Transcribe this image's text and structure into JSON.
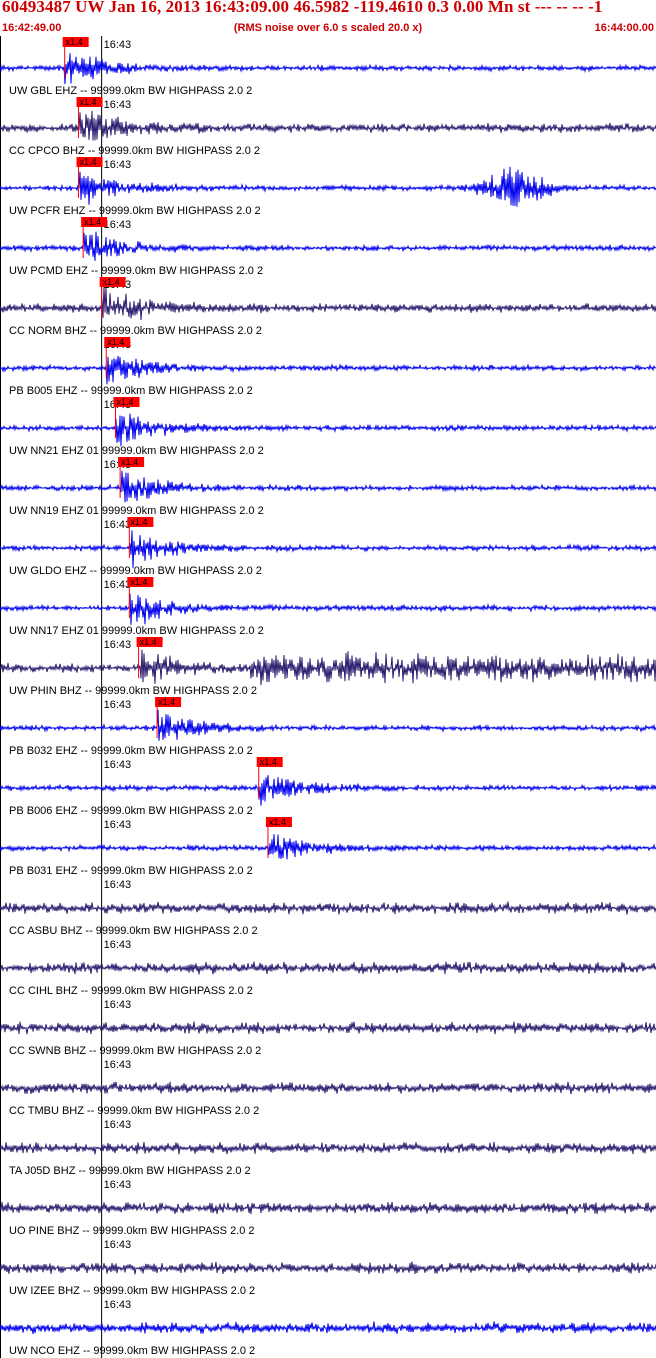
{
  "header": {
    "title": "60493487 UW Jan 16, 2013 16:43:09.00   46.5982 -119.4610  0.3 0.00 Mn st --- -- --  -1",
    "start_time": "16:42:49.00",
    "noise_note": "(RMS noise over 6.0 s scaled 20.0 x)",
    "end_time": "16:44:00.00"
  },
  "colors": {
    "title": "#cc0000",
    "trace_blue": "#0000ee",
    "trace_dark": "#2a1a6e",
    "pick_box": "#ff0000",
    "tick_line": "#000000"
  },
  "chart_data": {
    "type": "line",
    "time_axis": {
      "start": "16:42:49.00",
      "end": "16:44:00.00",
      "minute_label": "16:43",
      "minute_tick": "16:43:00"
    },
    "pick_label": "x1.4",
    "traces": [
      {
        "label": "UW GBL EHZ -- 99999.0km BW  HIGHPASS  2.0  2",
        "color": "blue",
        "pick_time": "16:42:56.0"
      },
      {
        "label": "CC CPCO BHZ -- 99999.0km BW  HIGHPASS  2.0  2",
        "color": "dark",
        "pick_time": "16:42:57.5"
      },
      {
        "label": "UW PCFR EHZ -- 99999.0km BW  HIGHPASS  2.0  2",
        "color": "blue",
        "pick_time": "16:42:57.5"
      },
      {
        "label": "UW PCMD EHZ -- 99999.0km BW  HIGHPASS  2.0  2",
        "color": "blue",
        "pick_time": "16:42:58.0"
      },
      {
        "label": "CC NORM BHZ -- 99999.0km BW  HIGHPASS  2.0  2",
        "color": "dark",
        "pick_time": "16:43:00.0"
      },
      {
        "label": "PB B005 EHZ -- 99999.0km BW  HIGHPASS  2.0  2",
        "color": "blue",
        "pick_time": "16:43:00.5"
      },
      {
        "label": "UW NN21 EHZ 01 99999.0km BW  HIGHPASS  2.0  2",
        "color": "blue",
        "pick_time": "16:43:01.5"
      },
      {
        "label": "UW NN19 EHZ 01 99999.0km BW  HIGHPASS  2.0  2",
        "color": "blue",
        "pick_time": "16:43:02.0"
      },
      {
        "label": "UW GLDO EHZ -- 99999.0km BW  HIGHPASS  2.0  2",
        "color": "blue",
        "pick_time": "16:43:03.0"
      },
      {
        "label": "UW NN17 EHZ 01 99999.0km BW  HIGHPASS  2.0  2",
        "color": "blue",
        "pick_time": "16:43:03.0"
      },
      {
        "label": "UW PHIN BHZ -- 99999.0km BW  HIGHPASS  2.0  2",
        "color": "dark",
        "pick_time": "16:43:04.0"
      },
      {
        "label": "PB B032 EHZ -- 99999.0km BW  HIGHPASS  2.0  2",
        "color": "blue",
        "pick_time": "16:43:06.0"
      },
      {
        "label": "PB B006 EHZ -- 99999.0km BW  HIGHPASS  2.0  2",
        "color": "blue",
        "pick_time": "16:43:17.0"
      },
      {
        "label": "PB B031 EHZ -- 99999.0km BW  HIGHPASS  2.0  2",
        "color": "blue",
        "pick_time": "16:43:18.0"
      },
      {
        "label": "CC ASBU BHZ -- 99999.0km BW  HIGHPASS  2.0  2",
        "color": "dark",
        "pick_time": null
      },
      {
        "label": "CC CIHL BHZ -- 99999.0km BW  HIGHPASS  2.0  2",
        "color": "dark",
        "pick_time": null
      },
      {
        "label": "CC SWNB BHZ -- 99999.0km BW  HIGHPASS  2.0  2",
        "color": "dark",
        "pick_time": null
      },
      {
        "label": "CC TMBU BHZ -- 99999.0km BW  HIGHPASS  2.0  2",
        "color": "dark",
        "pick_time": null
      },
      {
        "label": "TA J05D BHZ -- 99999.0km BW  HIGHPASS  2.0  2",
        "color": "dark",
        "pick_time": null
      },
      {
        "label": "UO PINE BHZ -- 99999.0km BW  HIGHPASS  2.0  2",
        "color": "dark",
        "pick_time": null
      },
      {
        "label": "UW IZEE BHZ -- 99999.0km BW  HIGHPASS  2.0  2",
        "color": "dark",
        "pick_time": null
      },
      {
        "label": "UW NCO EHZ -- 99999.0km BW  HIGHPASS  2.0  2",
        "color": "blue",
        "pick_time": null
      }
    ]
  }
}
